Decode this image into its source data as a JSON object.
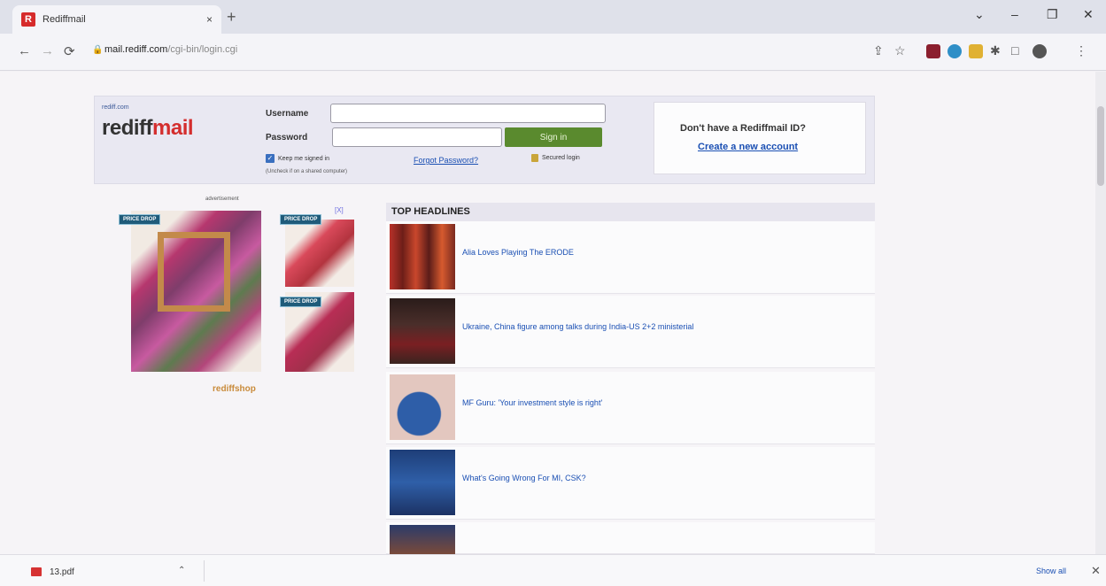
{
  "browser": {
    "tab_title": "Rediffmail",
    "tab_close": "×",
    "new_tab": "+",
    "url_host": "mail.rediff.com",
    "url_path": "/cgi-bin/login.cgi",
    "window_controls": {
      "chevron": "⌄",
      "minimize": "–",
      "restore": "❐",
      "close": "✕"
    },
    "nav": {
      "back": "←",
      "forward": "→",
      "reload": "⟳"
    },
    "toolbar_icons": [
      "share-icon",
      "star-icon",
      "extension-red-icon",
      "extension-blue-icon",
      "extension-yellow-icon",
      "puzzle-icon",
      "sidebar-icon",
      "profile-icon",
      "menu-icon"
    ]
  },
  "login": {
    "logo_small": "rediff.com",
    "logo_part1": "rediff",
    "logo_part2": "mail",
    "username_label": "Username",
    "password_label": "Password",
    "signin_label": "Sign in",
    "keep_signed_in": "Keep me signed in",
    "keep_note": "(Uncheck if on a shared computer)",
    "forgot_password": "Forgot Password?",
    "secure_login": "Secured login"
  },
  "signup": {
    "question": "Don't have a Rediffmail ID?",
    "link": "Create a new account"
  },
  "ad": {
    "label": "advertisement",
    "close": "[X]",
    "badge": "PRICE DROP",
    "brand": "rediffshop"
  },
  "headlines": {
    "title": "TOP HEADLINES",
    "items": [
      {
        "text": "Alia Loves Playing The ERODE"
      },
      {
        "text": "Ukraine, China figure among talks during India-US 2+2 ministerial"
      },
      {
        "text": "MF Guru: 'Your investment style is right'"
      },
      {
        "text": "What's Going Wrong For MI, CSK?"
      }
    ]
  },
  "downloads": {
    "file_name": "13.pdf",
    "caret": "⌃",
    "show_all": "Show all",
    "close": "✕"
  },
  "colors": {
    "brand_red": "#d42e2e",
    "link_blue": "#1a4fb3",
    "signin_green": "#5a8a2e"
  }
}
